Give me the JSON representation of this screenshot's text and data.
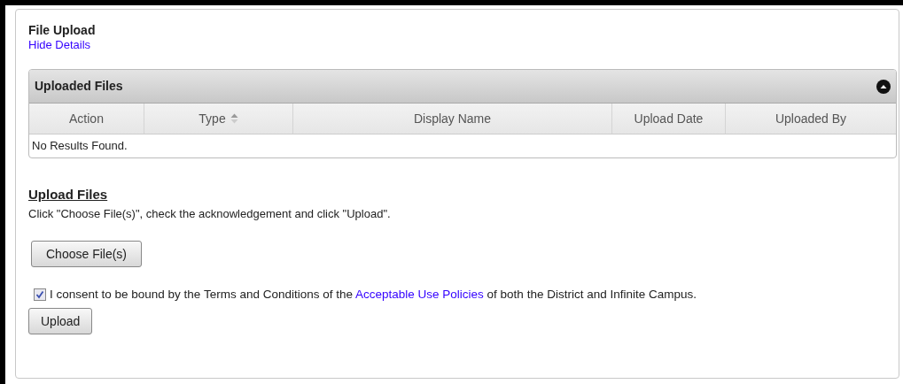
{
  "panel": {
    "title": "File Upload",
    "toggle_link": "Hide Details"
  },
  "uploaded_files": {
    "title": "Uploaded Files",
    "expanded": true,
    "columns": [
      {
        "label": "Action",
        "sortable": false
      },
      {
        "label": "Type",
        "sortable": true
      },
      {
        "label": "Display Name",
        "sortable": false
      },
      {
        "label": "Upload Date",
        "sortable": false
      },
      {
        "label": "Uploaded By",
        "sortable": false
      }
    ],
    "empty_message": "No Results Found."
  },
  "upload": {
    "heading": "Upload Files",
    "instructions": "Click \"Choose File(s)\", check the acknowledgement and click \"Upload\".",
    "choose_button": "Choose File(s)",
    "consent": {
      "checked": true,
      "text_before": "I consent to be bound by the Terms and Conditions of the",
      "link": "Acceptable Use Policies",
      "text_after": "of both the District and Infinite Campus."
    },
    "upload_button": "Upload"
  }
}
